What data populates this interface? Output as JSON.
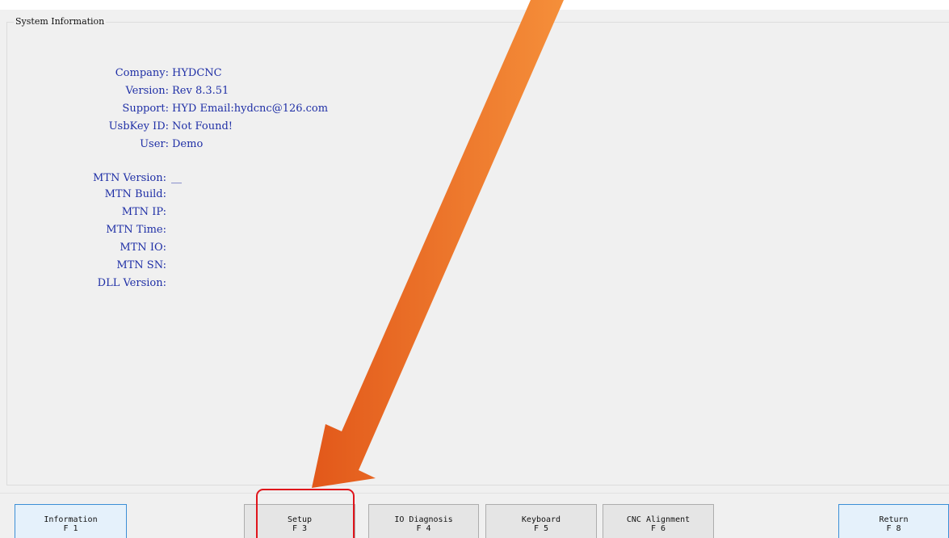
{
  "group": {
    "title": "System Information"
  },
  "info_rows": [
    {
      "label": "Company:",
      "value": "HYDCNC"
    },
    {
      "label": "Version:",
      "value": "Rev 8.3.51"
    },
    {
      "label": "Support:",
      "value": "HYD Email:hydcnc@126.com"
    },
    {
      "label": "UsbKey ID:",
      "value": "Not Found!"
    },
    {
      "label": "User:",
      "value": "Demo"
    }
  ],
  "mtn_rows": [
    {
      "label": "MTN Version:",
      "value": "__"
    },
    {
      "label": "MTN Build:",
      "value": ""
    },
    {
      "label": "MTN IP:",
      "value": ""
    },
    {
      "label": "MTN Time:",
      "value": ""
    },
    {
      "label": "MTN IO:",
      "value": ""
    },
    {
      "label": "MTN SN:",
      "value": ""
    },
    {
      "label": "DLL Version:",
      "value": ""
    }
  ],
  "function_keys": [
    {
      "label": "Information",
      "key": "F 1",
      "active": true
    },
    {
      "label": "Setup",
      "key": "F 3",
      "active": false
    },
    {
      "label": "IO Diagnosis",
      "key": "F 4",
      "active": false
    },
    {
      "label": "Keyboard",
      "key": "F 5",
      "active": false
    },
    {
      "label": "CNC Alignment",
      "key": "F 6",
      "active": false
    },
    {
      "label": "Return",
      "key": "F 8",
      "active": true
    }
  ],
  "annotation": {
    "arrow_color": "#f07a26",
    "highlight_color": "#e0141b",
    "target": "Setup"
  }
}
